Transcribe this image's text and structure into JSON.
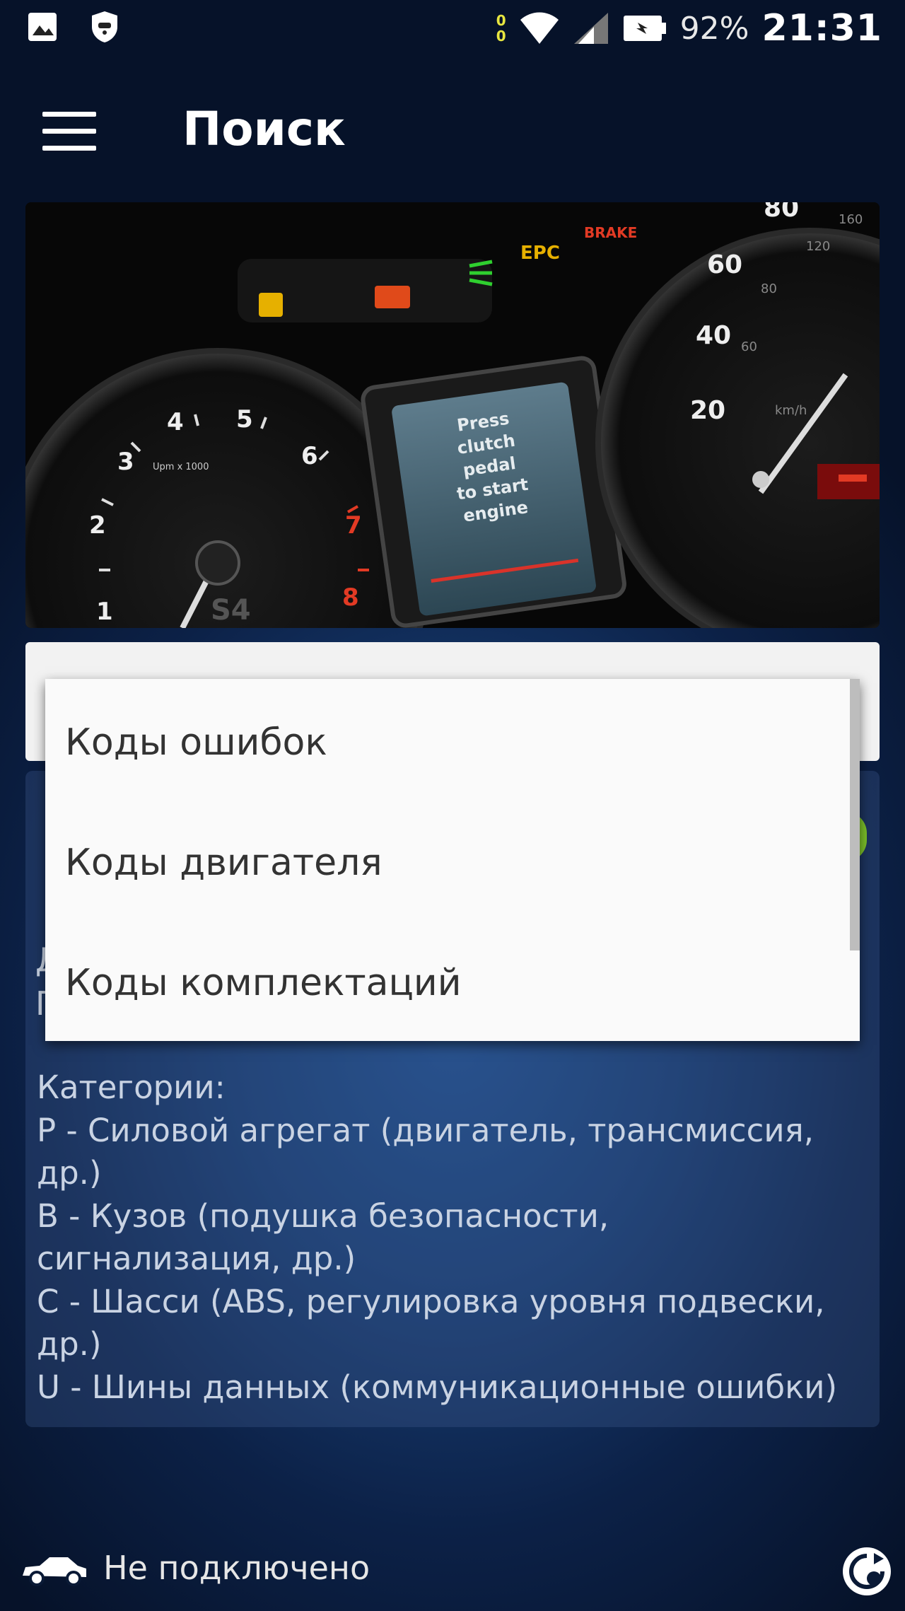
{
  "status_bar": {
    "battery_percent": "92%",
    "time": "21:31",
    "data_dots": [
      "0",
      "0"
    ],
    "icons": [
      "image-icon",
      "shield-icon",
      "wifi-icon",
      "signal-icon",
      "battery-icon"
    ]
  },
  "app_bar": {
    "title": "Поиск",
    "menu_icon": "hamburger-menu-icon"
  },
  "hero": {
    "display_lines": [
      "Press",
      "clutch",
      "pedal",
      "to start",
      "engine"
    ],
    "tacho_numbers": [
      "1",
      "2",
      "3",
      "4",
      "5",
      "6",
      "7",
      "8"
    ],
    "tacho_unit": "Upm x 1000",
    "speedo_numbers": [
      "20",
      "40",
      "60",
      "80"
    ],
    "speedo_small": [
      "60",
      "80",
      "120",
      "160"
    ],
    "speedo_unit": "km/h",
    "warning_labels": [
      "EPC",
      "BRAKE"
    ],
    "model_badge": "S4"
  },
  "dropdown": {
    "options": [
      "Коды ошибок",
      "Коды двигателя",
      "Коды комплектаций"
    ]
  },
  "info": {
    "peek_line1": "Д",
    "peek_line2": "П",
    "peek_line2_end": ".",
    "categories_lines": [
      "Категории:",
      "P - Силовой агрегат (двигатель, трансмиссия,",
      "др.)",
      "B - Кузов (подушка безопасности,",
      "сигнализация, др.)",
      "C - Шасси (ABS, регулировка уровня подвески,",
      "др.)",
      "U - Шины данных (коммуникационные ошибки)"
    ]
  },
  "bottom": {
    "connection_status": "Не подключено",
    "car_icon": "car-icon",
    "refresh_icon": "refresh-icon"
  }
}
